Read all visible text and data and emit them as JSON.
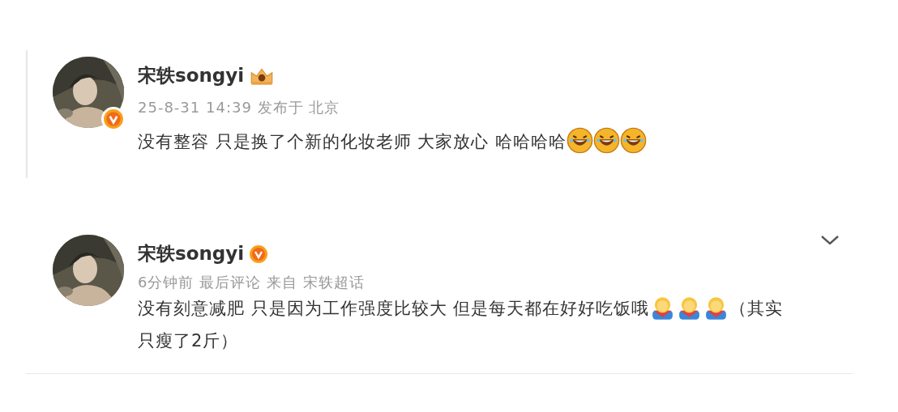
{
  "posts": [
    {
      "kind": "quoted",
      "username": "宋轶songyi",
      "badge": {
        "kind": "crown"
      },
      "avatar_verified": true,
      "meta": "25-8-31 14:39 发布于 北京",
      "has_menu": false,
      "content": [
        {
          "kind": "text",
          "text": "没有整容 只是换了个新的化妆老师 大家放心 哈哈哈哈"
        },
        {
          "kind": "laugh_emoji"
        },
        {
          "kind": "laugh_emoji"
        },
        {
          "kind": "laugh_emoji"
        }
      ]
    },
    {
      "kind": "comment",
      "username": "宋轶songyi",
      "badge": {
        "kind": "verified"
      },
      "avatar_verified": false,
      "meta": "6分钟前 最后评论 来自 宋轶超话",
      "has_menu": true,
      "content": [
        {
          "kind": "text",
          "text": "没有刻意减肥 只是因为工作强度比较大 但是每天都在好好吃饭哦"
        },
        {
          "kind": "person_emoji"
        },
        {
          "kind": "person_emoji"
        },
        {
          "kind": "person_emoji"
        },
        {
          "kind": "text",
          "text": "（其实"
        },
        {
          "kind": "text",
          "text": "只瘦了2斤）"
        }
      ]
    }
  ]
}
